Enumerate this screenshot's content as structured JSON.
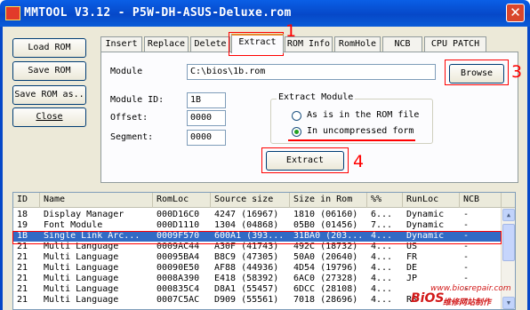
{
  "window": {
    "title": "MMTOOL V3.12 - P5W-DH-ASUS-Deluxe.rom",
    "close_glyph": "✕"
  },
  "left_buttons": [
    "Load ROM",
    "Save ROM",
    "Save ROM as..",
    "Close"
  ],
  "tabs": [
    "Insert",
    "Replace",
    "Delete",
    "Extract",
    "ROM Info",
    "RomHole",
    "NCB",
    "CPU PATCH"
  ],
  "active_tab": "Extract",
  "form": {
    "module_label": "Module",
    "module_path": "C:\\bios\\1b.rom",
    "browse_label": "Browse",
    "module_id_label": "Module ID:",
    "module_id": "1B",
    "offset_label": "Offset:",
    "offset": "0000",
    "segment_label": "Segment:",
    "segment": "0000",
    "extract_label": "Extract"
  },
  "extract_module": {
    "title": "Extract Module",
    "options": [
      "As is in the ROM file",
      "In uncompressed form"
    ],
    "selected": "In uncompressed form"
  },
  "annotations": [
    "1",
    "2",
    "3",
    "4"
  ],
  "table": {
    "columns": [
      "ID",
      "Name",
      "RomLoc",
      "Source size",
      "Size in Rom",
      "%%",
      "RunLoc",
      "NCB"
    ],
    "rows": [
      [
        "18",
        "Display Manager",
        "000D16C0",
        "4247 (16967)",
        "1810 (06160)",
        "6...",
        "Dynamic",
        "-"
      ],
      [
        "19",
        "Font Module",
        "000D1110",
        "1304 (04868)",
        "05B0 (01456)",
        "7...",
        "Dynamic",
        "-"
      ],
      [
        "1B",
        "Single Link Arc...",
        "0009F570",
        "600A1 (393...",
        "31BA0 (203...",
        "4...",
        "Dynamic",
        "-"
      ],
      [
        "21",
        "Multi Language",
        "0009AC44",
        "A30F (41743)",
        "492C (18732)",
        "4...",
        "US",
        "-"
      ],
      [
        "21",
        "Multi Language",
        "00095BA4",
        "B8C9 (47305)",
        "50A0 (20640)",
        "4...",
        "FR",
        "-"
      ],
      [
        "21",
        "Multi Language",
        "00090E50",
        "AF88 (44936)",
        "4D54 (19796)",
        "4...",
        "DE",
        "-"
      ],
      [
        "21",
        "Multi Language",
        "0008A390",
        "E418 (58392)",
        "6AC0 (27328)",
        "4...",
        "JP",
        "-"
      ],
      [
        "21",
        "Multi Language",
        "000835C4",
        "D8A1 (55457)",
        "6DCC (28108)",
        "4...",
        "",
        "-"
      ],
      [
        "21",
        "Multi Language",
        "0007C5AC",
        "D909 (55561)",
        "7018 (28696)",
        "4...",
        "RS",
        "-"
      ]
    ],
    "selected_row": 2
  },
  "scrollbar": {
    "up_glyph": "▲",
    "down_glyph": "▼"
  },
  "watermark": {
    "url": "www.biosrepair.com",
    "logo": "BiOS",
    "cn": "维修网站制作"
  },
  "colors": {
    "annotation": "#ff0000",
    "selection": "#316ac5",
    "titlebar": "#0648c8"
  }
}
